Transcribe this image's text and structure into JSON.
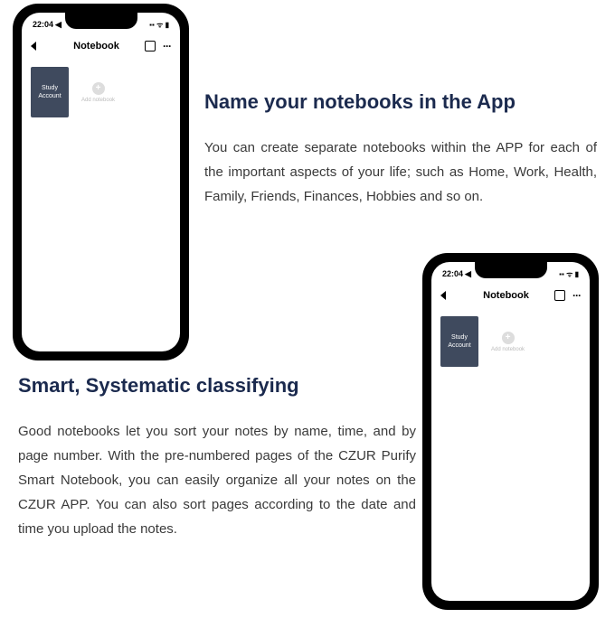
{
  "phone": {
    "status_time": "22:04",
    "status_location_icon": "◀",
    "status_signal": "▪▪ ᯤ ▮",
    "nav_title": "Notebook",
    "nav_more": "···",
    "notebook_line1": "Study",
    "notebook_line2": "Account",
    "add_plus": "+",
    "add_label": "Add notebook"
  },
  "section1": {
    "heading": "Name your notebooks in the App",
    "body": "You can create separate notebooks within the APP for each of the important aspects of your life; such as Home, Work, Health, Family, Friends, Finances, Hobbies and so on."
  },
  "section2": {
    "heading": "Smart, Systematic classifying",
    "body": "Good notebooks let you sort your notes by name, time, and by page number. With the pre-numbered pages of the CZUR Purify Smart Notebook, you can easily organize all your notes on the CZUR APP. You can also sort pages according to the date and time you upload the notes."
  }
}
